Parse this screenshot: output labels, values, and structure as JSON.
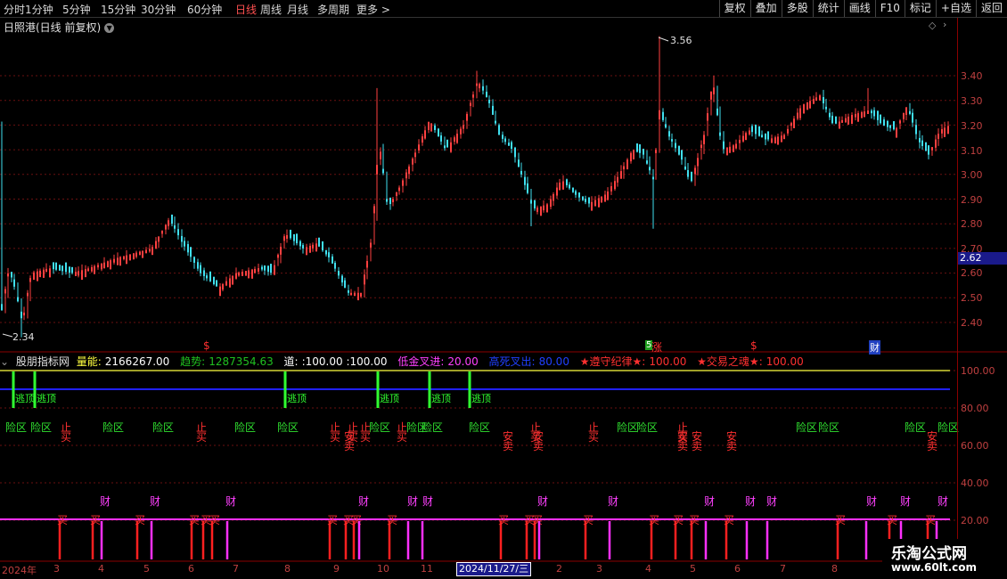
{
  "toolbar": {
    "periods": [
      {
        "label": "分时",
        "active": false
      },
      {
        "label": "1分钟",
        "active": false
      },
      {
        "label": "5分钟",
        "active": false
      },
      {
        "label": "15分钟",
        "active": false
      },
      {
        "label": "30分钟",
        "active": false
      },
      {
        "label": "60分钟",
        "active": false
      },
      {
        "label": "日线",
        "active": true
      },
      {
        "label": "周线",
        "active": false
      },
      {
        "label": "月线",
        "active": false
      },
      {
        "label": "多周期",
        "active": false
      },
      {
        "label": "更多 >",
        "active": false
      }
    ],
    "right_buttons": [
      "复权",
      "叠加",
      "多股",
      "统计",
      "画线",
      "F10",
      "标记",
      "+自选",
      "返回"
    ]
  },
  "main_chart": {
    "title": "日照港(日线 前复权)",
    "y_ticks": [
      "3.40",
      "3.30",
      "3.20",
      "3.10",
      "3.00",
      "2.90",
      "2.80",
      "2.70",
      "2.60",
      "2.50",
      "2.40"
    ],
    "current_price": "2.62",
    "high_label": "3.56",
    "low_label": "2.34",
    "markers": [
      "$",
      "5",
      "涨",
      "$",
      "财"
    ]
  },
  "indicator": {
    "name": "股朋指标网",
    "fields": [
      {
        "label": "量能:",
        "value": "2166267.00",
        "color": "#ffffff"
      },
      {
        "label": "趋势:",
        "value": "1287354.63",
        "color": "#20c020"
      },
      {
        "label": "道:",
        "value": ":100.00 :100.00",
        "color": "#ffffff"
      },
      {
        "label": "低金叉进:",
        "value": "20.00",
        "color": "#ff40ff"
      },
      {
        "label": "高死叉出:",
        "value": "80.00",
        "color": "#2040ff"
      },
      {
        "label": "★遵守纪律★:",
        "value": "100.00",
        "color": "#ff3030"
      },
      {
        "label": "★交易之魂★:",
        "value": "100.00",
        "color": "#ff3030"
      }
    ],
    "y_ticks": [
      "100.00",
      "80.00",
      "60.00",
      "40.00",
      "20.00"
    ],
    "labels": {
      "danger": "险区",
      "stop": "止",
      "buy": "买",
      "safe": "安",
      "sell": "卖",
      "fortune": "财",
      "escape": "逃顶"
    }
  },
  "bottom_axis": {
    "year": "2024年",
    "months": [
      "3",
      "4",
      "5",
      "6",
      "7",
      "8",
      "9",
      "10",
      "11",
      "2",
      "3",
      "4",
      "5",
      "6",
      "7",
      "8"
    ],
    "selected_date": "2024/11/27/三"
  },
  "watermark": {
    "title": "乐淘公式网",
    "url": "www.60lt.com"
  },
  "chart_data": {
    "type": "candlestick",
    "y_range": [
      2.34,
      3.56
    ],
    "indicator_range": [
      0,
      100
    ]
  }
}
